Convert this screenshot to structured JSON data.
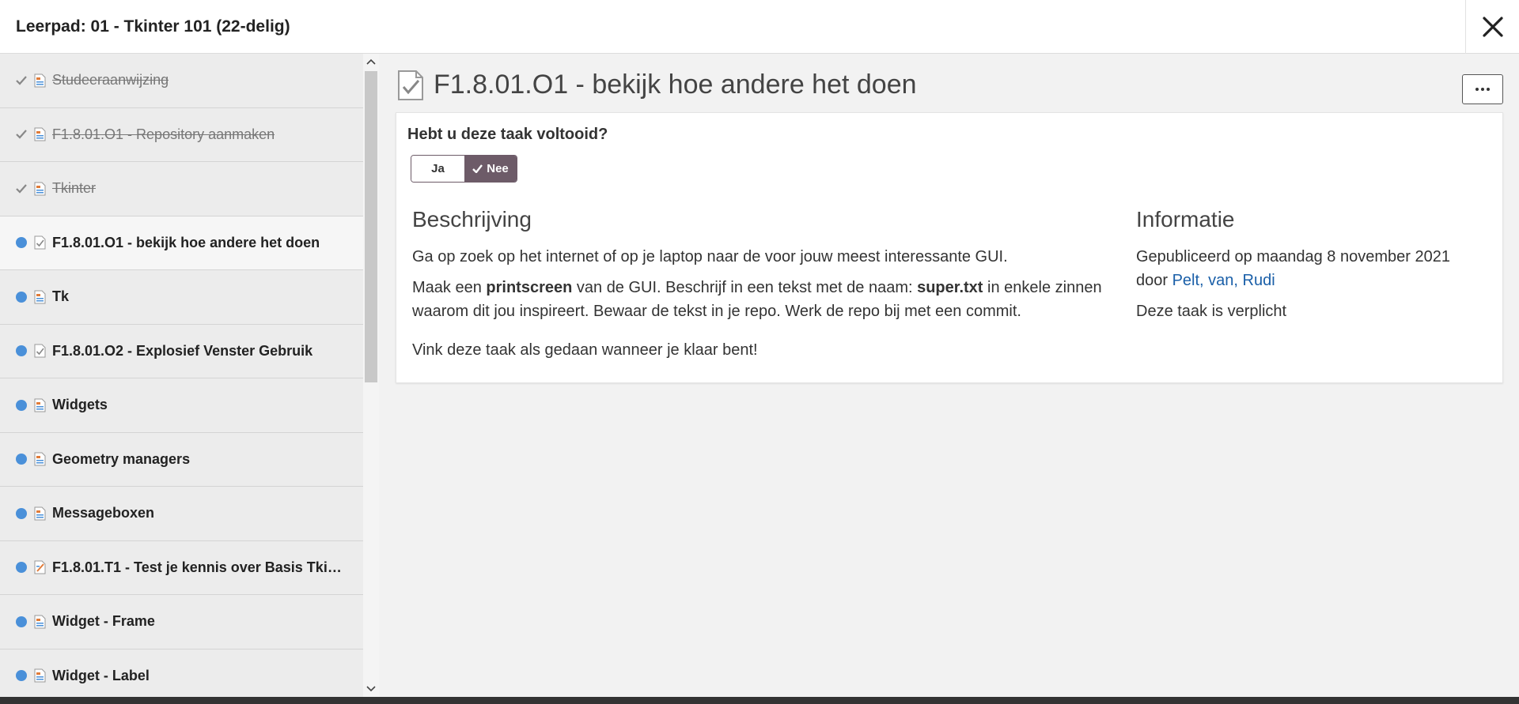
{
  "header": {
    "title": "Leerpad: 01 - Tkinter 101 (22-delig)"
  },
  "sidebar": {
    "items": [
      {
        "label": "Studeeraanwijzing",
        "status": "done",
        "icon": "document-icon"
      },
      {
        "label": "F1.8.01.O1 - Repository aanmaken",
        "status": "done",
        "icon": "document-icon"
      },
      {
        "label": "Tkinter",
        "status": "done",
        "icon": "document-icon"
      },
      {
        "label": "F1.8.01.O1 - bekijk hoe andere het doen",
        "status": "todo",
        "icon": "task-icon",
        "active": true
      },
      {
        "label": "Tk",
        "status": "todo",
        "icon": "document-icon"
      },
      {
        "label": "F1.8.01.O2 - Explosief Venster Gebruik",
        "status": "todo",
        "icon": "task-icon"
      },
      {
        "label": "Widgets",
        "status": "todo",
        "icon": "document-icon"
      },
      {
        "label": "Geometry managers",
        "status": "todo",
        "icon": "document-icon"
      },
      {
        "label": "Messageboxen",
        "status": "todo",
        "icon": "document-icon"
      },
      {
        "label": "F1.8.01.T1 - Test je kennis over Basis Tkin...",
        "status": "todo",
        "icon": "test-icon"
      },
      {
        "label": "Widget - Frame",
        "status": "todo",
        "icon": "document-icon"
      },
      {
        "label": "Widget - Label",
        "status": "todo",
        "icon": "document-icon"
      }
    ]
  },
  "content": {
    "title": "F1.8.01.O1 - bekijk hoe andere het doen",
    "question": "Hebt u deze taak voltooid?",
    "toggle": {
      "yes": "Ja",
      "no": "Nee",
      "selected": "no"
    },
    "description": {
      "heading": "Beschrijving",
      "p1": "Ga op zoek op het internet of op je laptop naar de voor jouw meest interessante GUI.",
      "p2_a": "Maak een ",
      "p2_b": "printscreen",
      "p2_c": " van de GUI. Beschrijf in een tekst met de naam: ",
      "p2_d": "super.txt",
      "p2_e": " in enkele zinnen waarom dit jou inspireert. Bewaar de tekst in je repo. Werk de repo bij met een commit.",
      "p3": "Vink deze taak als gedaan wanneer je klaar bent!"
    },
    "info": {
      "heading": "Informatie",
      "published_prefix": "Gepubliceerd op maandag 8 november 2021 door ",
      "author": "Pelt, van, Rudi",
      "mandatory": "Deze taak is verplicht"
    }
  },
  "colors": {
    "accent": "#6d5b68",
    "dot": "#4a90d9",
    "link": "#1a5fa8"
  }
}
